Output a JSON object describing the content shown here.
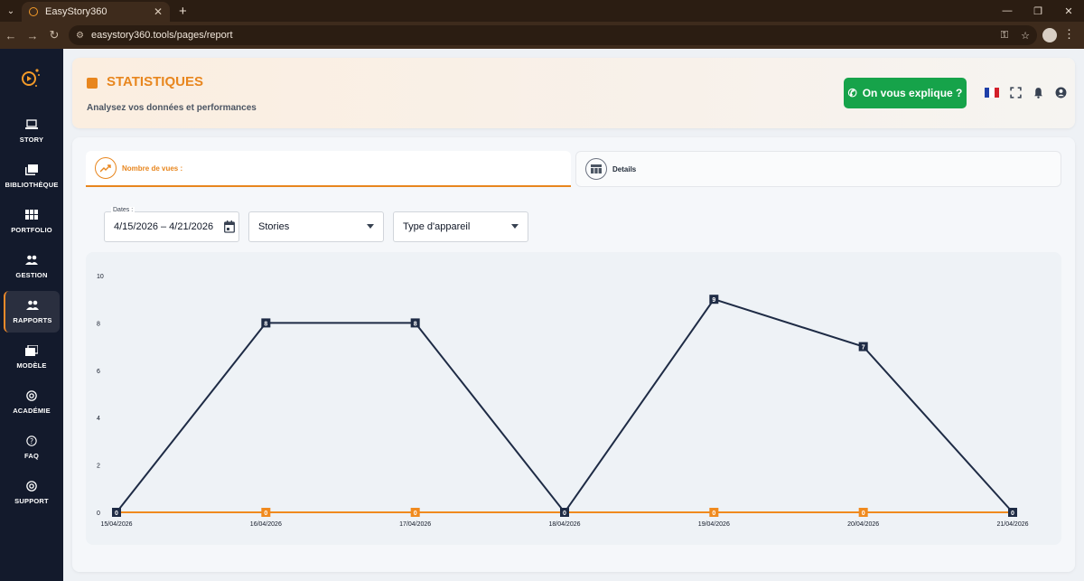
{
  "browser": {
    "tab_title": "EasyStory360",
    "url": "easystory360.tools/pages/report"
  },
  "sidebar": {
    "items": [
      {
        "label": "STORY",
        "icon": "laptop-icon"
      },
      {
        "label": "BIBLIOTHÈQUE",
        "icon": "library-icon"
      },
      {
        "label": "PORTFOLIO",
        "icon": "grid-icon"
      },
      {
        "label": "GESTION",
        "icon": "users-icon"
      },
      {
        "label": "RAPPORTS",
        "icon": "users-icon",
        "active": true
      },
      {
        "label": "MODÈLE",
        "icon": "template-icon"
      },
      {
        "label": "ACADÉMIE",
        "icon": "lifebuoy-icon"
      },
      {
        "label": "FAQ",
        "icon": "question-icon"
      },
      {
        "label": "SUPPORT",
        "icon": "lifebuoy-icon"
      }
    ]
  },
  "header": {
    "title": "STATISTIQUES",
    "subtitle": "Analysez vos données et performances",
    "explain_button": "On vous explique ?"
  },
  "tabs": {
    "views": "Nombre de vues :",
    "details": "Details"
  },
  "filters": {
    "dates_legend": "Dates :",
    "dates_value": "4/15/2026 – 4/21/2026",
    "stories": "Stories",
    "device": "Type d'appareil"
  },
  "colors": {
    "accent": "#e8861e",
    "green": "#16a34a",
    "sidebar": "#131a2c",
    "series_dark": "#1e2b45",
    "series_orange": "#f08a1e"
  },
  "chart_data": {
    "type": "line",
    "x": [
      "15/04/2026",
      "16/04/2026",
      "17/04/2026",
      "18/04/2026",
      "19/04/2026",
      "20/04/2026",
      "21/04/2026"
    ],
    "series": [
      {
        "values": [
          0,
          8,
          8,
          0,
          9,
          7,
          0
        ],
        "color": "#1e2b45"
      },
      {
        "values": [
          0,
          0,
          0,
          0,
          0,
          0,
          0
        ],
        "color": "#f08a1e"
      }
    ],
    "yticks": [
      0,
      2,
      4,
      6,
      8,
      10
    ],
    "ylim": [
      0,
      10
    ],
    "grid": false
  }
}
